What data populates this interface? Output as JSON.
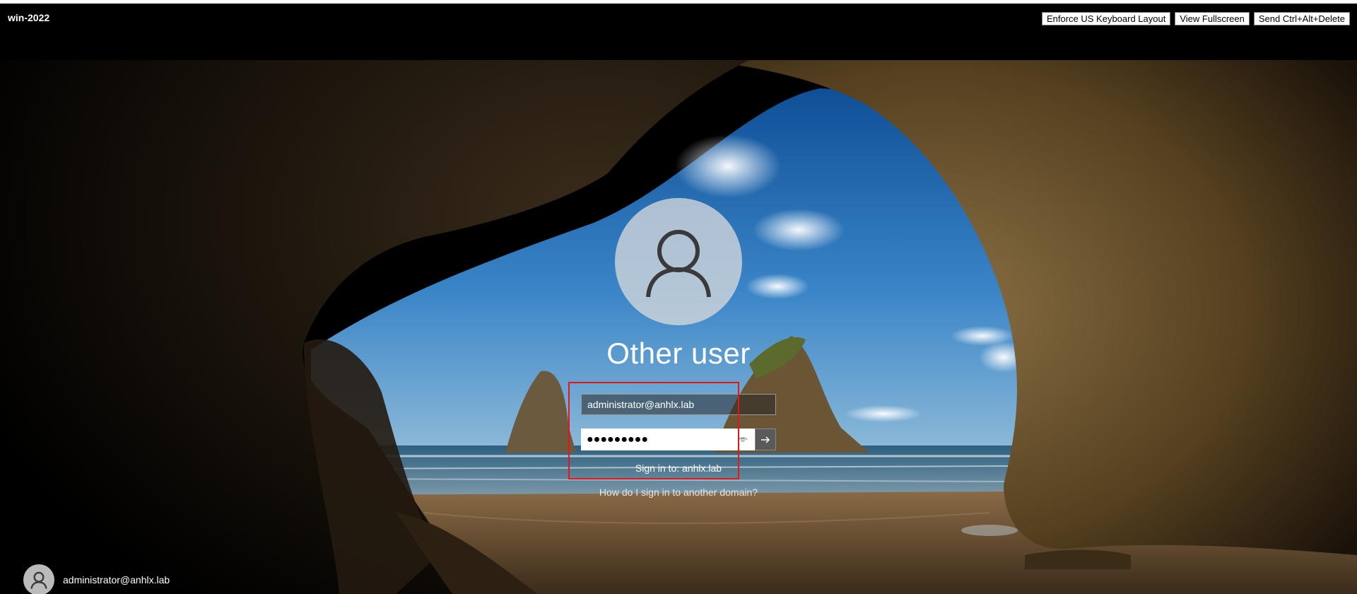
{
  "session": {
    "host_title": "win-2022"
  },
  "toolbar": {
    "buttons": [
      {
        "label": "Enforce US Keyboard Layout"
      },
      {
        "label": "View Fullscreen"
      },
      {
        "label": "Send Ctrl+Alt+Delete"
      }
    ]
  },
  "login": {
    "user_title": "Other user",
    "username_value": "administrator@anhlx.lab",
    "password_mask": "●●●●●●●●●",
    "sign_in_to": "Sign in to: anhlx.lab",
    "other_domain_link": "How do I sign in to another domain?"
  },
  "bottom_user": {
    "name": "administrator@anhlx.lab"
  },
  "icons": {
    "avatar": "user-silhouette-icon",
    "reveal": "eye-icon",
    "submit": "arrow-right-icon"
  },
  "colors": {
    "highlight": "#e01818",
    "sky": "#2a6fb4",
    "rock": "#5a4526"
  }
}
